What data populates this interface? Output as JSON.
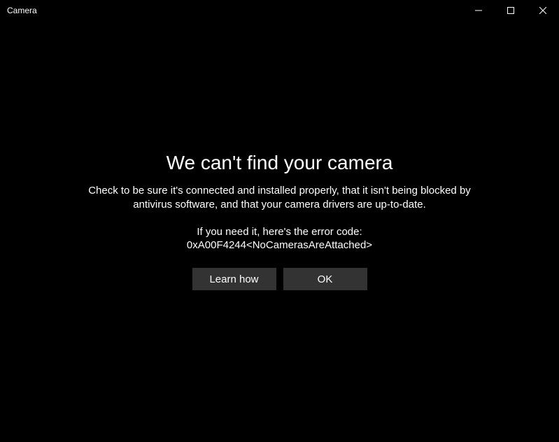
{
  "titlebar": {
    "title": "Camera"
  },
  "error": {
    "heading": "We can't find your camera",
    "description": "Check to be sure it's connected and installed properly, that it isn't being blocked by antivirus software, and that your camera drivers are up-to-date.",
    "code_prompt": "If you need it, here's the error code:",
    "code": "0xA00F4244<NoCamerasAreAttached>"
  },
  "buttons": {
    "learn_how": "Learn how",
    "ok": "OK"
  }
}
